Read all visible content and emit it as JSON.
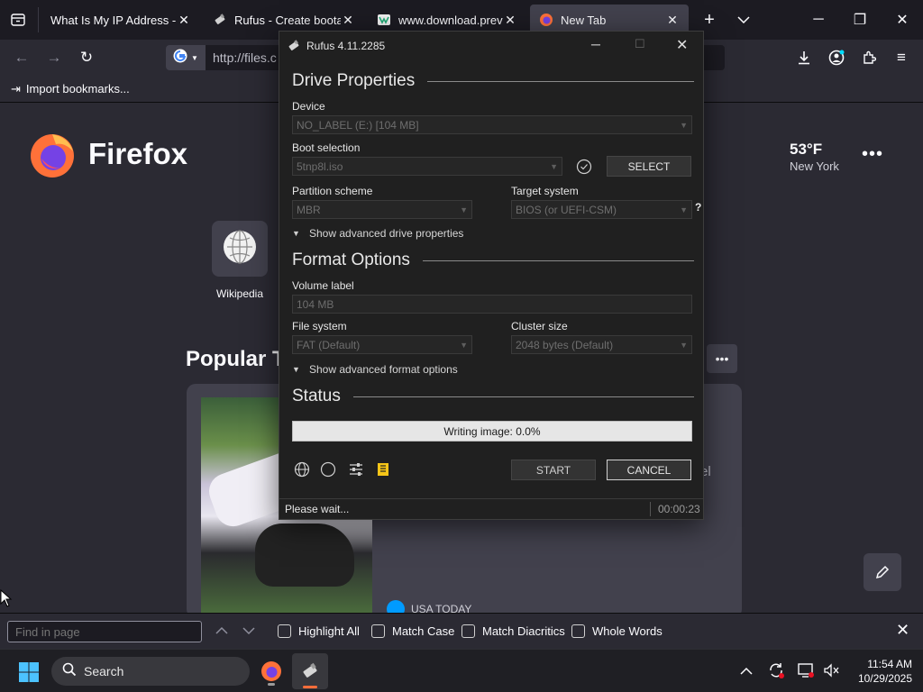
{
  "browser": {
    "tabs": [
      {
        "title": "What Is My IP Address - Se",
        "favicon": "ip-site-icon",
        "active": false
      },
      {
        "title": "Rufus - Create bootabl",
        "favicon": "rufus-usb-icon",
        "active": false
      },
      {
        "title": "www.download.previo",
        "favicon": "download-site-icon",
        "active": false
      },
      {
        "title": "New Tab",
        "favicon": "firefox-icon",
        "active": true
      }
    ],
    "url": "http://files.c",
    "bookmarks_import": "Import bookmarks..."
  },
  "newtab": {
    "logo_text": "Firefox",
    "weather": {
      "temp": "53°F",
      "city": "New York"
    },
    "shortcut": {
      "label": "Wikipedia"
    },
    "popular_heading": "Popular T",
    "story_source": "USA TODAY",
    "story_fragment": "el"
  },
  "rufus": {
    "title": "Rufus 4.11.2285",
    "drive_properties": {
      "heading": "Drive Properties",
      "device_label": "Device",
      "device_value": "NO_LABEL (E:) [104 MB]",
      "boot_label": "Boot selection",
      "boot_value": "5tnp8l.iso",
      "select_button": "SELECT",
      "partition_label": "Partition scheme",
      "partition_value": "MBR",
      "target_label": "Target system",
      "target_value": "BIOS (or UEFI-CSM)",
      "target_help": "?",
      "advanced": "Show advanced drive properties"
    },
    "format_options": {
      "heading": "Format Options",
      "volume_label": "Volume label",
      "volume_value": "104 MB",
      "fs_label": "File system",
      "fs_value": "FAT (Default)",
      "cluster_label": "Cluster size",
      "cluster_value": "2048 bytes (Default)",
      "advanced": "Show advanced format options"
    },
    "status": {
      "heading": "Status",
      "progress_text": "Writing image: 0.0%",
      "progress": 0.0
    },
    "start_button": "START",
    "cancel_button": "CANCEL",
    "footer_status": "Please wait...",
    "elapsed": "00:00:23"
  },
  "findbar": {
    "placeholder": "Find in page",
    "options": [
      "Highlight All",
      "Match Case",
      "Match Diacritics",
      "Whole Words"
    ]
  },
  "taskbar": {
    "search_label": "Search",
    "time": "11:54 AM",
    "date": "10/29/2025"
  },
  "colors": {
    "accent_firefox": "#ff7139",
    "rufus_bg": "#202020",
    "browser_bg": "#2b2a33"
  }
}
